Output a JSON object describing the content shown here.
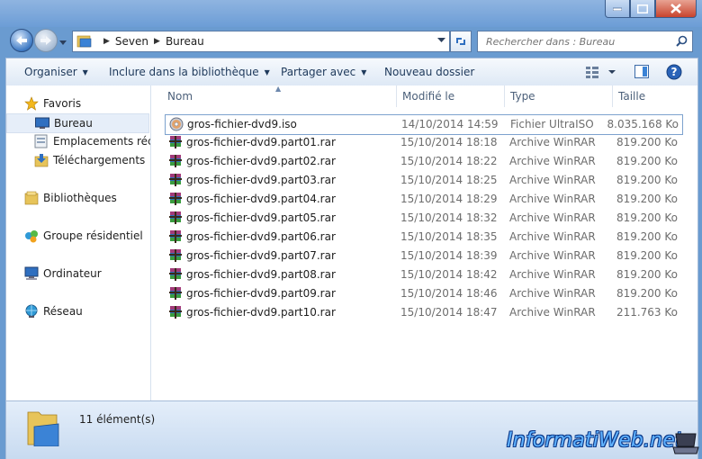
{
  "window": {
    "title": ""
  },
  "nav": {
    "breadcrumb": [
      "Seven",
      "Bureau"
    ],
    "search_placeholder": "Rechercher dans : Bureau"
  },
  "toolbar": {
    "organize": "Organiser",
    "include": "Inclure dans la bibliothèque",
    "share": "Partager avec",
    "new_folder": "Nouveau dossier"
  },
  "sidebar": {
    "favorites": "Favoris",
    "desktop": "Bureau",
    "recent": "Emplacements récents",
    "downloads": "Téléchargements",
    "libraries": "Bibliothèques",
    "homegroup": "Groupe résidentiel",
    "computer": "Ordinateur",
    "network": "Réseau"
  },
  "columns": {
    "name": "Nom",
    "modified": "Modifié le",
    "type": "Type",
    "size": "Taille"
  },
  "files": [
    {
      "name": "gros-fichier-dvd9.iso",
      "date": "14/10/2014 14:59",
      "type": "Fichier UltraISO",
      "size": "8.035.168 Ko",
      "icon": "iso-icon"
    },
    {
      "name": "gros-fichier-dvd9.part01.rar",
      "date": "15/10/2014 18:18",
      "type": "Archive WinRAR",
      "size": "819.200 Ko",
      "icon": "winrar-icon"
    },
    {
      "name": "gros-fichier-dvd9.part02.rar",
      "date": "15/10/2014 18:22",
      "type": "Archive WinRAR",
      "size": "819.200 Ko",
      "icon": "winrar-icon"
    },
    {
      "name": "gros-fichier-dvd9.part03.rar",
      "date": "15/10/2014 18:25",
      "type": "Archive WinRAR",
      "size": "819.200 Ko",
      "icon": "winrar-icon"
    },
    {
      "name": "gros-fichier-dvd9.part04.rar",
      "date": "15/10/2014 18:29",
      "type": "Archive WinRAR",
      "size": "819.200 Ko",
      "icon": "winrar-icon"
    },
    {
      "name": "gros-fichier-dvd9.part05.rar",
      "date": "15/10/2014 18:32",
      "type": "Archive WinRAR",
      "size": "819.200 Ko",
      "icon": "winrar-icon"
    },
    {
      "name": "gros-fichier-dvd9.part06.rar",
      "date": "15/10/2014 18:35",
      "type": "Archive WinRAR",
      "size": "819.200 Ko",
      "icon": "winrar-icon"
    },
    {
      "name": "gros-fichier-dvd9.part07.rar",
      "date": "15/10/2014 18:39",
      "type": "Archive WinRAR",
      "size": "819.200 Ko",
      "icon": "winrar-icon"
    },
    {
      "name": "gros-fichier-dvd9.part08.rar",
      "date": "15/10/2014 18:42",
      "type": "Archive WinRAR",
      "size": "819.200 Ko",
      "icon": "winrar-icon"
    },
    {
      "name": "gros-fichier-dvd9.part09.rar",
      "date": "15/10/2014 18:46",
      "type": "Archive WinRAR",
      "size": "819.200 Ko",
      "icon": "winrar-icon"
    },
    {
      "name": "gros-fichier-dvd9.part10.rar",
      "date": "15/10/2014 18:47",
      "type": "Archive WinRAR",
      "size": "211.763 Ko",
      "icon": "winrar-icon"
    }
  ],
  "status": {
    "count": "11 élément(s)"
  },
  "watermark": "InformatiWeb.net"
}
